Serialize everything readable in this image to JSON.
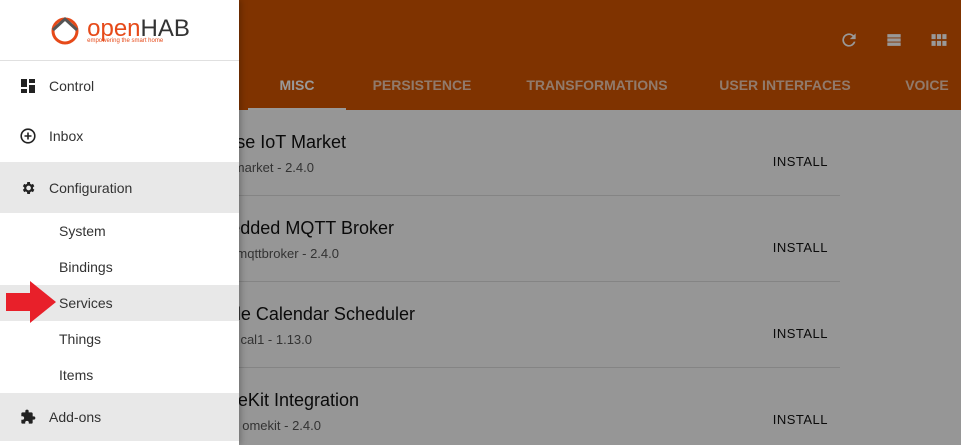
{
  "app": {
    "logo_open": "open",
    "logo_hab": "HAB",
    "logo_tagline": "empowering the smart home"
  },
  "toolbar": {
    "icons": [
      "refresh-icon",
      "list-view-icon",
      "grid-view-icon"
    ]
  },
  "tabs": [
    {
      "label": "MISC",
      "active": true
    },
    {
      "label": "PERSISTENCE",
      "active": false
    },
    {
      "label": "TRANSFORMATIONS",
      "active": false
    },
    {
      "label": "USER INTERFACES",
      "active": false
    },
    {
      "label": "VOICE",
      "active": false
    }
  ],
  "addons": [
    {
      "title": "se IoT Market",
      "subtitle": "market - 2.4.0",
      "action": "INSTALL"
    },
    {
      "title": "edded MQTT Broker",
      "subtitle": "mqttbroker - 2.4.0",
      "action": "INSTALL"
    },
    {
      "title": "le Calendar Scheduler",
      "subtitle": "cal1 - 1.13.0",
      "action": "INSTALL"
    },
    {
      "title": "eKit Integration",
      "subtitle": "omekit - 2.4.0",
      "action": "INSTALL"
    }
  ],
  "sidebar": {
    "items": [
      {
        "label": "Control",
        "icon": "dashboard-icon"
      },
      {
        "label": "Inbox",
        "icon": "add-circle-icon"
      },
      {
        "label": "Configuration",
        "icon": "gear-icon"
      }
    ],
    "config_sub": [
      {
        "label": "System"
      },
      {
        "label": "Bindings"
      },
      {
        "label": "Services"
      },
      {
        "label": "Things"
      },
      {
        "label": "Items"
      }
    ],
    "addons_item": {
      "label": "Add-ons",
      "icon": "puzzle-icon"
    }
  },
  "colors": {
    "header": "#d45500",
    "arrow": "#e8202a"
  }
}
